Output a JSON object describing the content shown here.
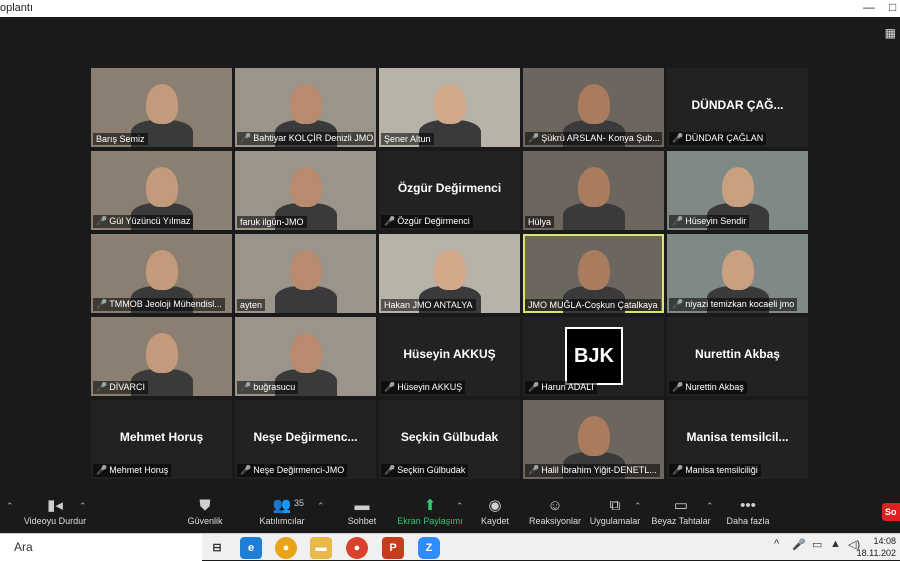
{
  "window": {
    "title": "oplantı",
    "minimize": "—",
    "close": "□"
  },
  "gallery": {
    "tiles": [
      {
        "name": "Barış Semiz",
        "muted": false,
        "video": true
      },
      {
        "name": "Bahtiyar KOLÇİR Denizli JMO",
        "muted": true,
        "video": true
      },
      {
        "name": "Şener Altun",
        "muted": false,
        "video": true
      },
      {
        "name": "Şükrü ARSLAN- Konya Şub...",
        "muted": true,
        "video": true
      },
      {
        "name": "DÜNDAR ÇAĞLAN",
        "display": "DÜNDAR ÇAĞ...",
        "muted": true,
        "video": false
      },
      {
        "name": "Gül Yüzüncü Yılmaz",
        "muted": true,
        "video": true
      },
      {
        "name": "faruk ilgün-JMO",
        "muted": false,
        "video": true
      },
      {
        "name": "Özgür Değirmenci",
        "display": "Özgür Değirmenci",
        "muted": true,
        "video": false
      },
      {
        "name": "Hülya",
        "muted": false,
        "video": true
      },
      {
        "name": "Hüseyin Sendir",
        "muted": true,
        "video": true
      },
      {
        "name": "TMMOB Jeoloji Mühendisl...",
        "muted": true,
        "video": true
      },
      {
        "name": "ayten",
        "muted": false,
        "video": true
      },
      {
        "name": "Hakan JMO ANTALYA",
        "muted": false,
        "video": true
      },
      {
        "name": "JMO MUĞLA-Coşkun Çatalkaya",
        "muted": false,
        "video": true,
        "active": true
      },
      {
        "name": "niyazi temizkan kocaeli jmo",
        "muted": true,
        "video": true
      },
      {
        "name": "DİVARCI",
        "muted": true,
        "video": true
      },
      {
        "name": "buğrasucu",
        "muted": true,
        "video": true
      },
      {
        "name": "Hüseyin AKKUŞ",
        "display": "Hüseyin AKKUŞ",
        "muted": true,
        "video": false
      },
      {
        "name": "Harun ADALI",
        "muted": true,
        "video": false,
        "logo": "BJK"
      },
      {
        "name": "Nurettin Akbaş",
        "display": "Nurettin Akbaş",
        "muted": true,
        "video": false
      },
      {
        "name": "Mehmet Horuş",
        "display": "Mehmet Horuş",
        "muted": true,
        "video": false
      },
      {
        "name": "Neşe Değirmenci-JMO",
        "display": "Neşe  Değirmenc...",
        "muted": true,
        "video": false
      },
      {
        "name": "Seçkin Gülbudak",
        "display": "Seçkin Gülbudak",
        "muted": true,
        "video": false
      },
      {
        "name": "Halil İbrahim Yiğit-DENETL...",
        "muted": true,
        "video": true
      },
      {
        "name": "Manisa temsilciliği",
        "display": "Manisa  temsilcil...",
        "muted": true,
        "video": false
      }
    ]
  },
  "controls": {
    "video": "Videoyu Durdur",
    "security": "Güvenlik",
    "participants": "Katılımcılar",
    "participants_count": "35",
    "chat": "Sohbet",
    "share": "Ekran Paylaşımı",
    "record": "Kaydet",
    "reactions": "Reaksiyonlar",
    "apps": "Uygulamalar",
    "whiteboard": "Beyaz Tahtalar",
    "more": "Daha fazla",
    "end": "So"
  },
  "taskbar": {
    "search": "Ara",
    "time": "14:08",
    "date": "18.11.202"
  },
  "colors": {
    "active_border": "#d9e56b",
    "share_green": "#2ecc71",
    "end_red": "#e02020"
  }
}
